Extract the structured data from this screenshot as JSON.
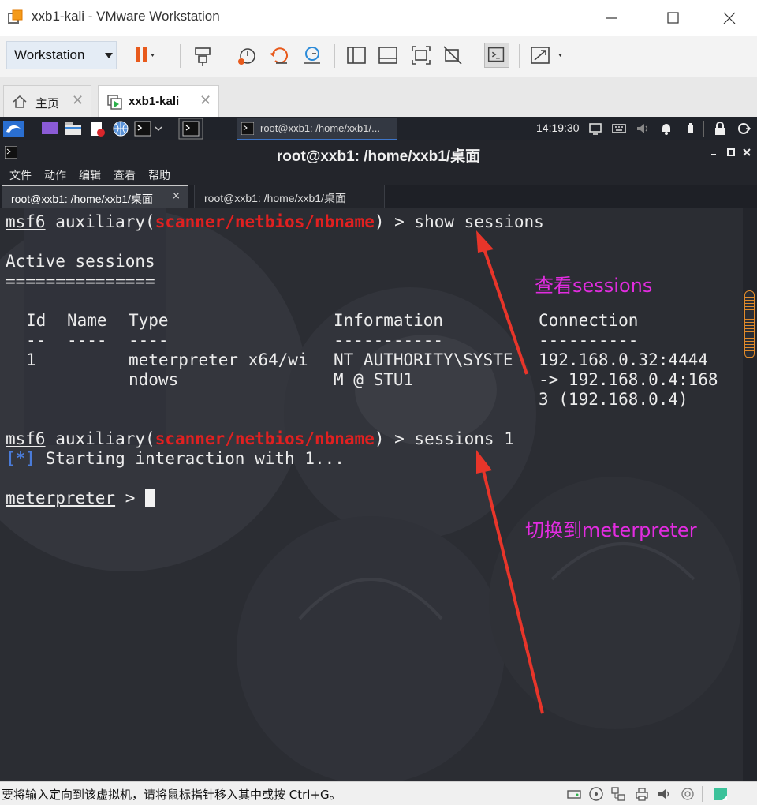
{
  "window": {
    "title": "xxb1-kali - VMware Workstation"
  },
  "toolbar": {
    "workstation_label": "Workstation"
  },
  "tabs": [
    {
      "label": "主页"
    },
    {
      "label": "xxb1-kali"
    }
  ],
  "kali_panel": {
    "task_label": "root@xxb1: /home/xxb1/...",
    "clock": "14:19:30"
  },
  "terminal": {
    "window_title": "root@xxb1: /home/xxb1/桌面",
    "menu": [
      "文件",
      "动作",
      "编辑",
      "查看",
      "帮助"
    ],
    "tabs": [
      {
        "label": "root@xxb1: /home/xxb1/桌面"
      },
      {
        "label": "root@xxb1: /home/xxb1/桌面"
      }
    ],
    "prompt_prefix": "msf6",
    "prompt_module_word": "auxiliary",
    "module": "scanner/netbios/nbname",
    "cmd1": "show sessions",
    "active_sessions_heading": "Active sessions",
    "heading_rule": "===============",
    "table": {
      "headers": [
        "Id",
        "Name",
        "Type",
        "Information",
        "Connection"
      ],
      "rules": [
        "--",
        "----",
        "----",
        "-----------",
        "----------"
      ],
      "row": {
        "id": "1",
        "name": "",
        "type_lines": [
          "meterpreter x64/wi",
          "ndows"
        ],
        "info_lines": [
          "NT AUTHORITY\\SYSTE",
          "M @ STU1"
        ],
        "conn_lines": [
          "192.168.0.32:4444",
          "-> 192.168.0.4:168",
          "3 (192.168.0.4)"
        ]
      }
    },
    "cmd2": "sessions 1",
    "info_marker": "[*]",
    "info_text": "Starting interaction with 1...",
    "meterpreter_prompt": "meterpreter"
  },
  "annotations": {
    "show_sessions_note": "查看sessions",
    "switch_note": "切换到meterpreter",
    "color": "#e22ce0"
  },
  "statusbar": {
    "message": "要将输入定向到该虚拟机，请将鼠标指针移入其中或按 Ctrl+G。"
  },
  "colors": {
    "module_red": "#e02020",
    "info_blue": "#4a7bd8",
    "arrow_red": "#e8352a",
    "accent_orange": "#e85a1c"
  }
}
